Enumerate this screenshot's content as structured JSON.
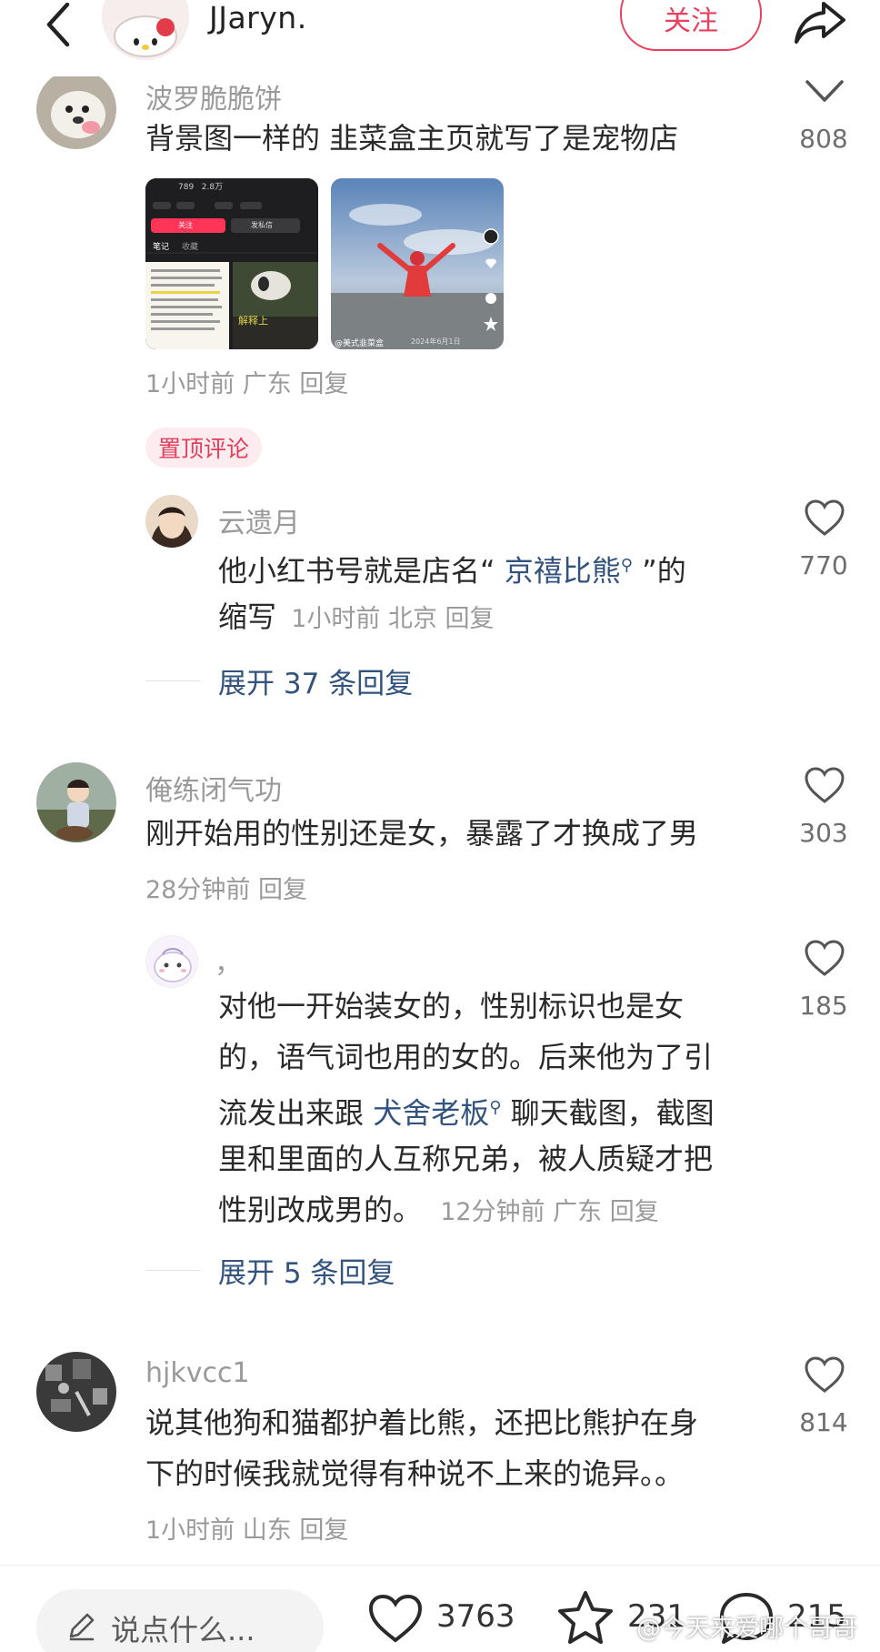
{
  "header": {
    "author_name": "JJaryn.",
    "follow_label": "关注"
  },
  "comments": [
    {
      "username": "波罗脆脆饼",
      "text": "背景图一样的 韭菜盒主页就写了是宠物店",
      "like_count": "808",
      "meta": "1小时前 广东 回复",
      "attachments": [
        {
          "type": "screenshot",
          "caption": "解释上",
          "tabs": [
            "笔记",
            "收藏"
          ],
          "follow": "关注",
          "message": "发私信",
          "stats": "789   2.8万"
        },
        {
          "type": "video",
          "caption": "@美式韭菜盒",
          "date": "2024年6月1日"
        }
      ]
    },
    {
      "pinned_label": "置顶评论",
      "username": "云遗月",
      "text_prefix": "他小红书号就是店名“ ",
      "link": "京禧比熊",
      "text_suffix": " ”的",
      "text_line2": "缩写",
      "meta": "1小时前 北京 回复",
      "like_count": "770",
      "expand": "展开 37 条回复"
    },
    {
      "username": "俺练闭气功",
      "text": "刚开始用的性别还是女，暴露了才换成了男",
      "like_count": "303",
      "meta": "28分钟前 回复"
    },
    {
      "username": "，",
      "lines": [
        "对他一开始装女的，性别标识也是女",
        "的，语气词也用的女的。后来他为了引"
      ],
      "line3_prefix": "流发出来跟 ",
      "link": "犬舍老板",
      "line3_suffix": " 聊天截图，截图",
      "line4": "里和里面的人互称兄弟，被人质疑才把",
      "line5": "性别改成男的。",
      "meta": "12分钟前 广东 回复",
      "like_count": "185",
      "expand": "展开 5 条回复"
    },
    {
      "username": "hjkvcc1",
      "lines": [
        "说其他狗和猫都护着比熊，还把比熊护在身",
        "下的时候我就觉得有种说不上来的诡异。。"
      ],
      "like_count": "814",
      "meta": "1小时前 山东 回复"
    }
  ],
  "bottom_bar": {
    "input_placeholder": "说点什么...",
    "likes": "3763",
    "collects": "231",
    "comments": "215"
  },
  "watermark": "@今天来爱哪个哥哥",
  "colors": {
    "accent_red": "#e8405d",
    "link_blue": "#33537f",
    "meta_gray": "#9a9a9a"
  },
  "icons": [
    "back-arrow-icon",
    "share-icon",
    "heart-icon",
    "pen-icon",
    "star-icon",
    "comment-bubble-icon",
    "search-icon"
  ]
}
